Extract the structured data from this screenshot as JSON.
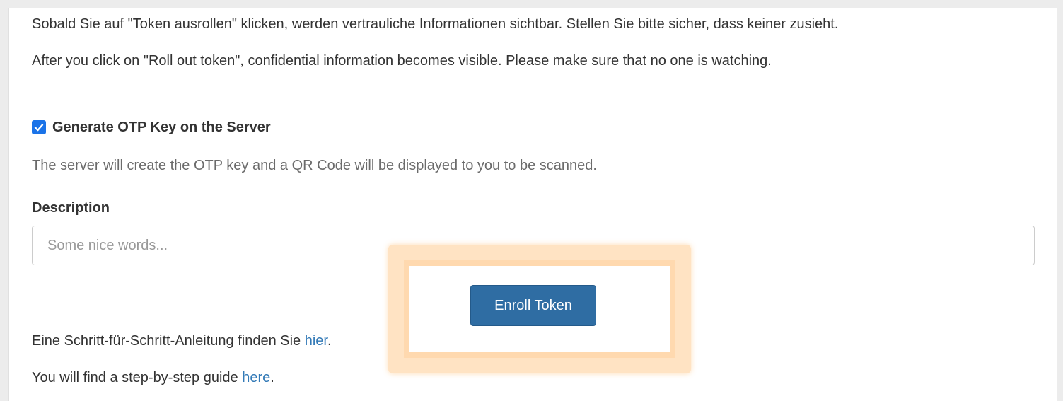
{
  "warning": {
    "de": "Sobald Sie auf \"Token ausrollen\" klicken, werden vertrauliche Informationen sichtbar. Stellen Sie bitte sicher, dass keiner zusieht.",
    "en": "After you click on \"Roll out token\", confidential information becomes visible. Please make sure that no one is watching."
  },
  "generate_key": {
    "label": "Generate OTP Key on the Server",
    "checked": true,
    "icon": "checkbox-checked-icon",
    "help": "The server will create the OTP key and a QR Code will be displayed to you to be scanned."
  },
  "description": {
    "label": "Description",
    "value": "",
    "placeholder": "Some nice words..."
  },
  "enroll_button": {
    "label": "Enroll Token",
    "color": "#2f6da3"
  },
  "guide": {
    "de_prefix": "Eine Schritt-für-Schritt-Anleitung finden Sie ",
    "de_link": "hier",
    "de_suffix": ".",
    "en_prefix": "You will find a step-by-step guide ",
    "en_link": "here",
    "en_suffix": "."
  },
  "colors": {
    "accent": "#1a73e8",
    "link": "#337ab7",
    "highlight": "#ffb052"
  }
}
